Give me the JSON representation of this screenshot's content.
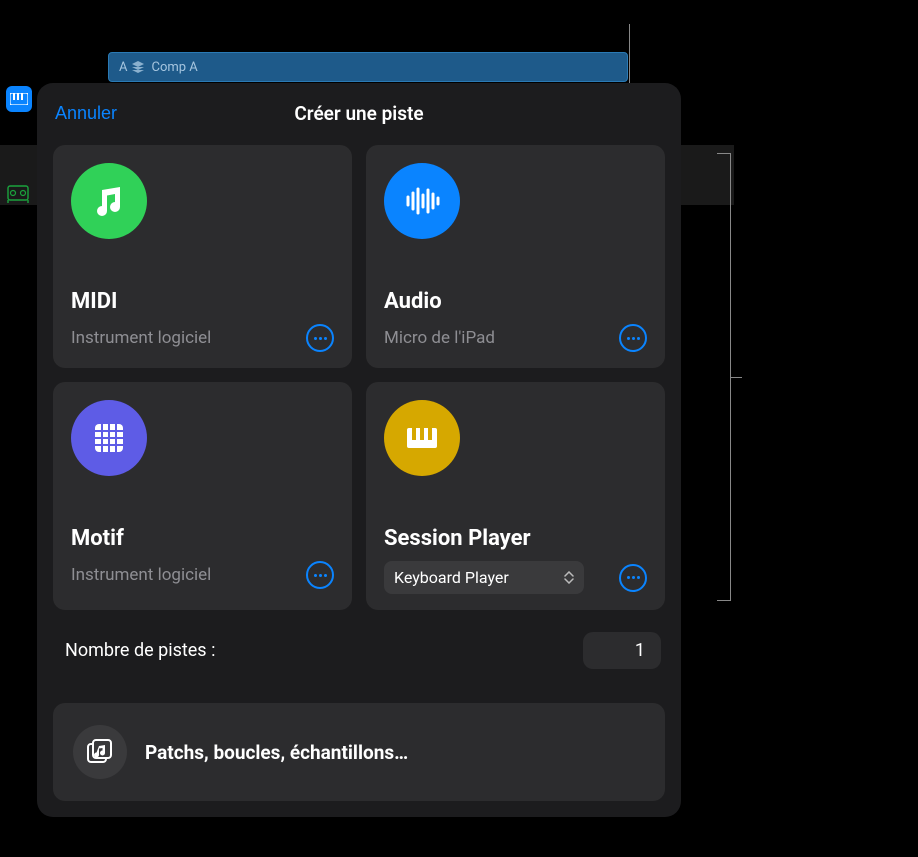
{
  "background": {
    "track_label": "A",
    "comp_label": "Comp A"
  },
  "modal": {
    "cancel": "Annuler",
    "title": "Créer une piste",
    "cards": {
      "midi": {
        "title": "MIDI",
        "subtitle": "Instrument logiciel"
      },
      "audio": {
        "title": "Audio",
        "subtitle": "Micro de l'iPad"
      },
      "motif": {
        "title": "Motif",
        "subtitle": "Instrument logiciel"
      },
      "session": {
        "title": "Session Player",
        "dropdown": "Keyboard Player"
      }
    },
    "track_count_label": "Nombre de pistes :",
    "track_count_value": "1",
    "browse_label": "Patchs, boucles, échantillons…"
  }
}
